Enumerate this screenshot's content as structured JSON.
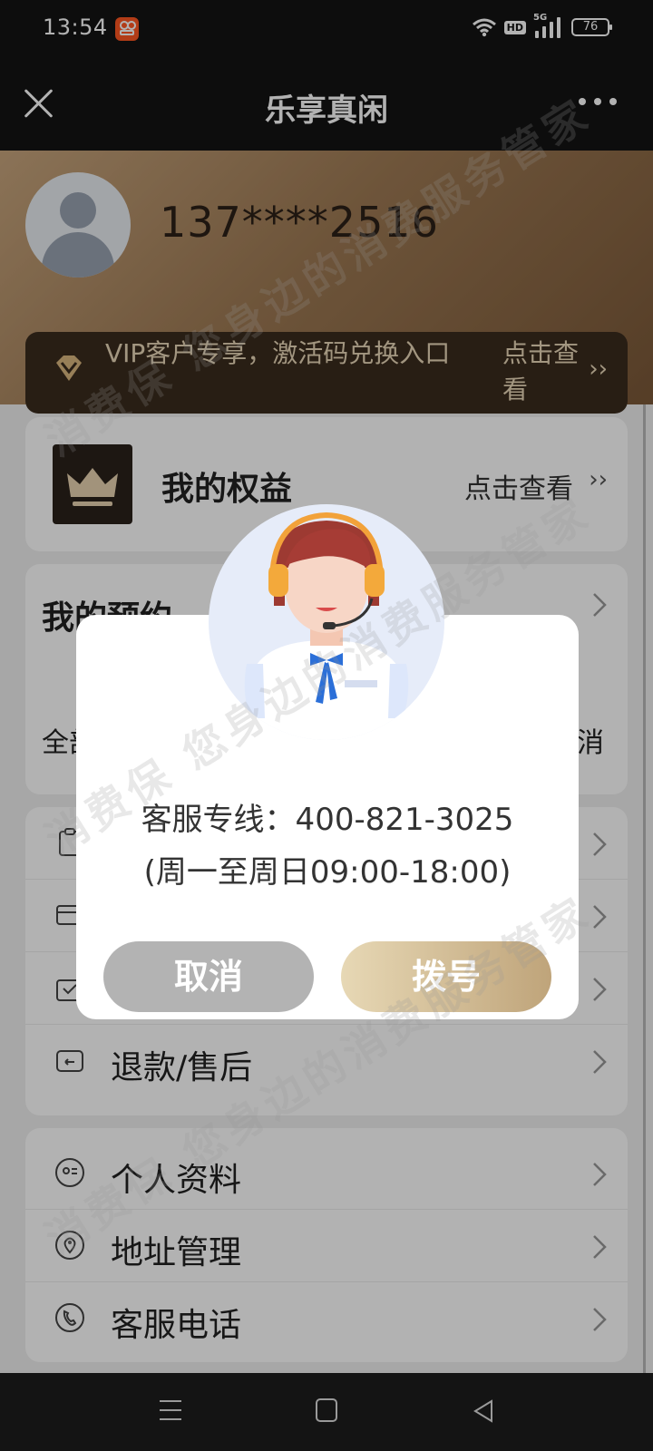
{
  "status_bar": {
    "time": "13:54",
    "hd": "HD",
    "network": "5G",
    "battery": "76"
  },
  "nav": {
    "title": "乐享真闲"
  },
  "profile": {
    "phone": "137****2516"
  },
  "vip_banner": {
    "text": "VIP客户专享，激活码兑换入口",
    "link": "点击查看",
    "arrows": "››"
  },
  "benefits": {
    "title": "我的权益",
    "link": "点击查看",
    "arrows": "››"
  },
  "booking": {
    "title": "我的预约",
    "tab_left": "全部",
    "tab_right": "取消"
  },
  "order_list": [
    {
      "label": "",
      "icon": "clipboard-icon"
    },
    {
      "label": "",
      "icon": "card-icon"
    },
    {
      "label": "",
      "icon": "package-icon"
    },
    {
      "label": "退款/售后",
      "icon": "refund-icon"
    }
  ],
  "settings_list": [
    {
      "label": "个人资料",
      "icon": "profile-card-icon"
    },
    {
      "label": "地址管理",
      "icon": "location-icon"
    },
    {
      "label": "客服电话",
      "icon": "phone-icon"
    }
  ],
  "dialog": {
    "hotline": "客服专线：400-821-3025",
    "hours": "(周一至周日09:00-18:00)",
    "cancel_label": "取消",
    "dial_label": "拨号"
  },
  "watermark": "消费保 您身边的消费服务管家",
  "colors": {
    "header_dark": "#141414",
    "gold": "#bfa47a",
    "cancel_grey": "#b3b3b3"
  }
}
